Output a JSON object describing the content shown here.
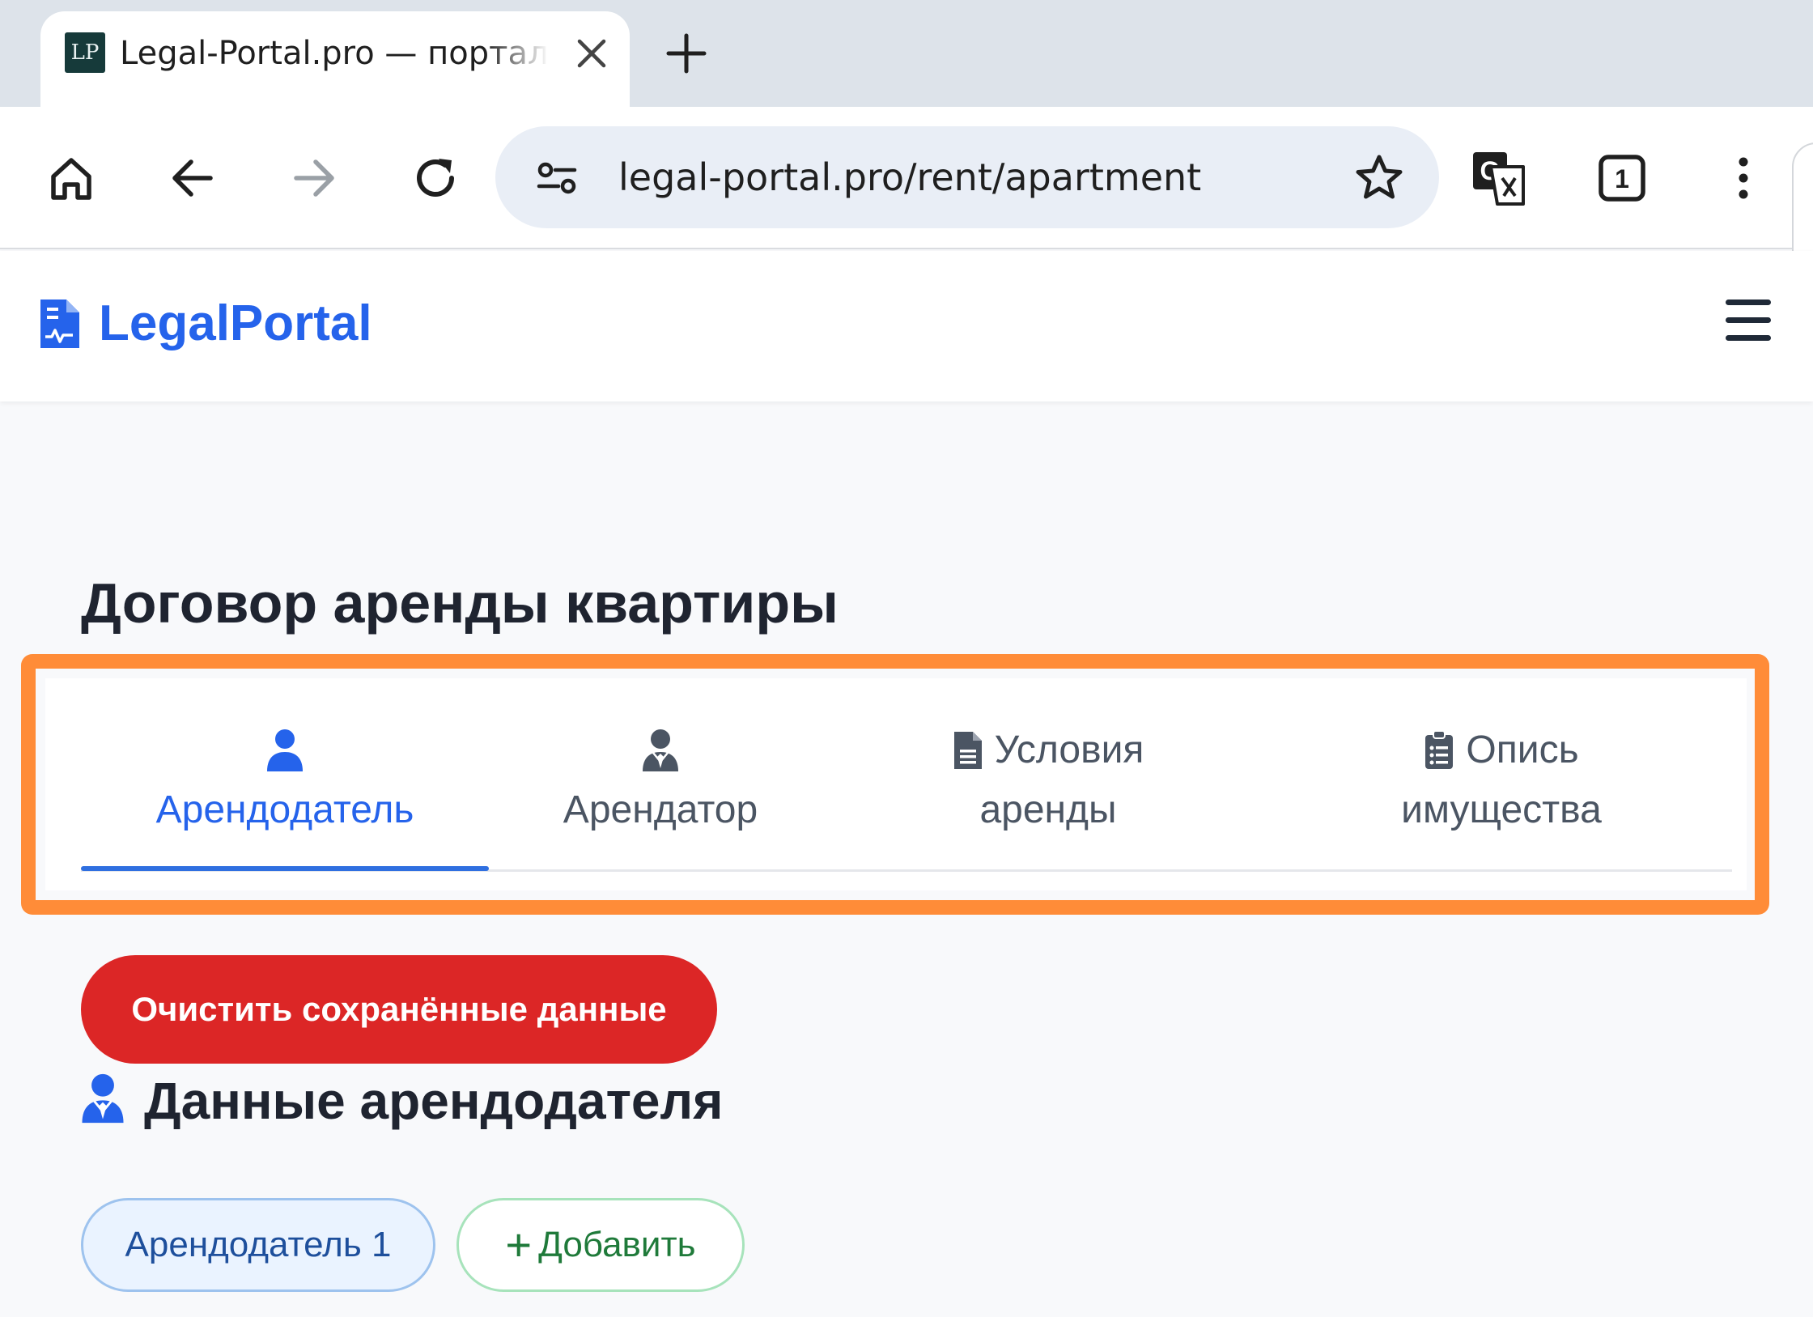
{
  "browser": {
    "tab_title": "Legal-Portal.pro — портал для юристов",
    "favicon_text": "LP",
    "url": "legal-portal.pro/rent/apartment",
    "tab_count": "1"
  },
  "site": {
    "brand": "LegalPortal"
  },
  "page": {
    "title": "Договор аренды квартиры",
    "tabs": [
      {
        "label_line1": "",
        "label_line2": "Арендодатель",
        "active": true
      },
      {
        "label_line1": "",
        "label_line2": "Арендатор",
        "active": false
      },
      {
        "label_line1": "Условия",
        "label_line2": "аренды",
        "active": false
      },
      {
        "label_line1": "Опись",
        "label_line2": "имущества",
        "active": false
      }
    ],
    "clear_button": "Очистить сохранённые данные",
    "section_title": "Данные арендодателя",
    "landlord_pill": "Арендодатель 1",
    "add_button": "Добавить",
    "add_plus": "+"
  },
  "colors": {
    "brand_blue": "#2563eb",
    "danger_red": "#dc2626",
    "highlight_orange": "#ff8c38",
    "success_green": "#1f7a3a"
  },
  "icons": [
    "home-icon",
    "back-arrow-icon",
    "forward-arrow-icon",
    "reload-icon",
    "site-settings-icon",
    "bookmark-star-icon",
    "translate-icon",
    "tab-counter-icon",
    "more-menu-icon",
    "document-logo-icon",
    "hamburger-icon",
    "user-icon",
    "user-tie-icon",
    "file-icon",
    "clipboard-list-icon"
  ]
}
